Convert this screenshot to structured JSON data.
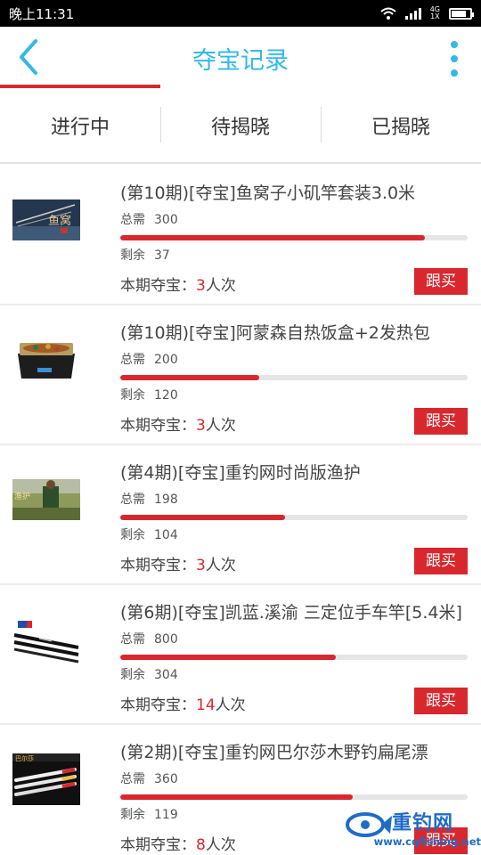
{
  "status_bar": {
    "time": "晚上11:31",
    "net_top": "4G",
    "net_bottom": "1X"
  },
  "header": {
    "title": "夺宝记录"
  },
  "tabs": [
    {
      "label": "进行中",
      "active": true
    },
    {
      "label": "待揭晓",
      "active": false
    },
    {
      "label": "已揭晓",
      "active": false
    }
  ],
  "labels": {
    "need": "总需",
    "remain": "剩余",
    "mine_prefix": "本期夺宝：",
    "mine_suffix": "人次",
    "follow": "跟买"
  },
  "records": [
    {
      "title": "(第10期)[夺宝]鱼窝子小矶竿套装3.0米",
      "need": "300",
      "remain": "37",
      "count": "3",
      "progress": 0.877
    },
    {
      "title": "(第10期)[夺宝]阿蒙森自热饭盒+2发热包",
      "need": "200",
      "remain": "120",
      "count": "3",
      "progress": 0.4
    },
    {
      "title": "(第4期)[夺宝]重钓网时尚版渔护",
      "need": "198",
      "remain": "104",
      "count": "3",
      "progress": 0.475
    },
    {
      "title": "(第6期)[夺宝]凯蓝.溪渝 三定位手车竿[5.4米]",
      "need": "800",
      "remain": "304",
      "count": "14",
      "progress": 0.62
    },
    {
      "title": "(第2期)[夺宝]重钓网巴尔莎木野钓扁尾漂",
      "need": "360",
      "remain": "119",
      "count": "8",
      "progress": 0.67
    }
  ],
  "watermark": {
    "brand": "重钓网",
    "url": "www.cqfishing.net"
  },
  "colors": {
    "accent": "#35b8e8",
    "red": "#d9272e"
  }
}
